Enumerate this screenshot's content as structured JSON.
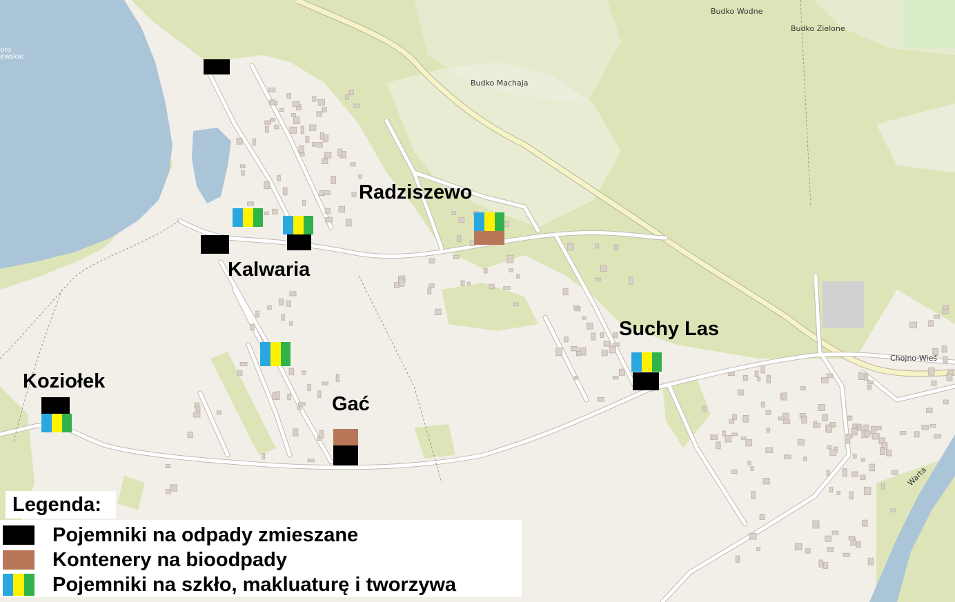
{
  "colors": {
    "mixed_waste": "#000000",
    "bio": "#b9775a",
    "segregated": [
      "#29a8e0",
      "#fff200",
      "#2fb34a"
    ],
    "water": "#aac4d8",
    "forest": "#dde5b8",
    "land": "#f2efe9"
  },
  "places": [
    {
      "name": "Radziszewo"
    },
    {
      "name": "Kalwaria"
    },
    {
      "name": "Suchy Las"
    },
    {
      "name": "Koziołek"
    },
    {
      "name": "Gać"
    }
  ],
  "map_labels": [
    "Budko Wodne",
    "Budko Zielone",
    "Budko Machaja",
    "Chojno-Wieś",
    "Warta",
    "oro",
    "ewskie"
  ],
  "legend": {
    "title": "Legenda:",
    "items": [
      {
        "icon": "mixed-waste-bin-icon",
        "label": "Pojemniki na odpady zmieszane"
      },
      {
        "icon": "bio-container-icon",
        "label": "Kontenery na bioodpady"
      },
      {
        "icon": "segregated-bin-icon",
        "label": "Pojemniki na szkło, makluaturę i tworzywa"
      }
    ]
  }
}
